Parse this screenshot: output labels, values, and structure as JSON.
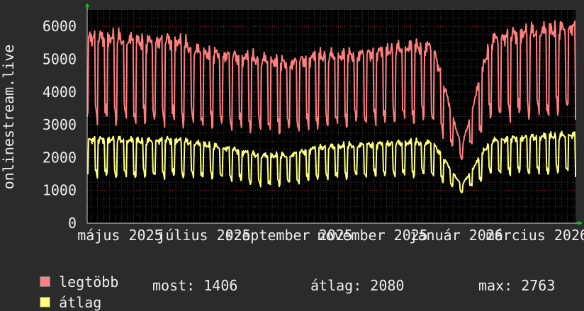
{
  "chart_data": {
    "type": "line",
    "ylabel": "onlinestream.live",
    "ylim": [
      0,
      6500
    ],
    "y_ticks": [
      "0",
      "1000",
      "2000",
      "3000",
      "4000",
      "5000",
      "6000"
    ],
    "x_ticks": [
      "május 2025",
      "július 2025",
      "szeptember 2025",
      "november 2025",
      "január 2026",
      "március 2026"
    ],
    "x_range": [
      "2025-04-07",
      "2026-03-29"
    ],
    "grid": true,
    "series": [
      {
        "name": "legtöbb",
        "color": "#ff7f7f",
        "weekly_dates": [
          "2025-04-07",
          "2025-04-28",
          "2025-05-19",
          "2025-06-09",
          "2025-06-30",
          "2025-07-21",
          "2025-08-11",
          "2025-09-01",
          "2025-09-22",
          "2025-10-13",
          "2025-11-03",
          "2025-11-24",
          "2025-12-15",
          "2026-01-05",
          "2026-01-26",
          "2026-02-16",
          "2026-03-09",
          "2026-03-29"
        ],
        "weekly_peak": [
          5800,
          5750,
          5650,
          5700,
          5300,
          5200,
          5100,
          4950,
          5200,
          5200,
          5300,
          5450,
          5500,
          2300,
          5700,
          5900,
          6000,
          6100
        ],
        "weekly_low": [
          2800,
          2750,
          2700,
          2700,
          2650,
          2600,
          2500,
          2500,
          2600,
          2700,
          2750,
          2800,
          2750,
          1900,
          2850,
          2900,
          2900,
          3100
        ],
        "last": 3150
      },
      {
        "name": "átlag",
        "color": "#ffff7f",
        "weekly_dates": [
          "2025-04-07",
          "2025-04-28",
          "2025-05-19",
          "2025-06-09",
          "2025-06-30",
          "2025-07-21",
          "2025-08-11",
          "2025-09-01",
          "2025-09-22",
          "2025-10-13",
          "2025-11-03",
          "2025-11-24",
          "2025-12-15",
          "2026-01-05",
          "2026-01-26",
          "2026-02-16",
          "2026-03-09",
          "2026-03-29"
        ],
        "weekly_peak": [
          2600,
          2600,
          2550,
          2600,
          2450,
          2300,
          2100,
          2100,
          2350,
          2400,
          2450,
          2500,
          2500,
          1150,
          2550,
          2650,
          2700,
          2750
        ],
        "weekly_low": [
          1300,
          1250,
          1250,
          1250,
          1250,
          1200,
          1000,
          1050,
          1200,
          1250,
          1300,
          1300,
          1300,
          900,
          1350,
          1350,
          1350,
          1400
        ],
        "last": 1406
      }
    ]
  },
  "legend": {
    "items": [
      {
        "label": "legtöbb",
        "color": "#ff7f7f"
      },
      {
        "label": "átlag",
        "color": "#ffff7f"
      }
    ]
  },
  "stats": {
    "now": "most: 1406",
    "avg": "átlag: 2080",
    "max": "max: 2763"
  }
}
